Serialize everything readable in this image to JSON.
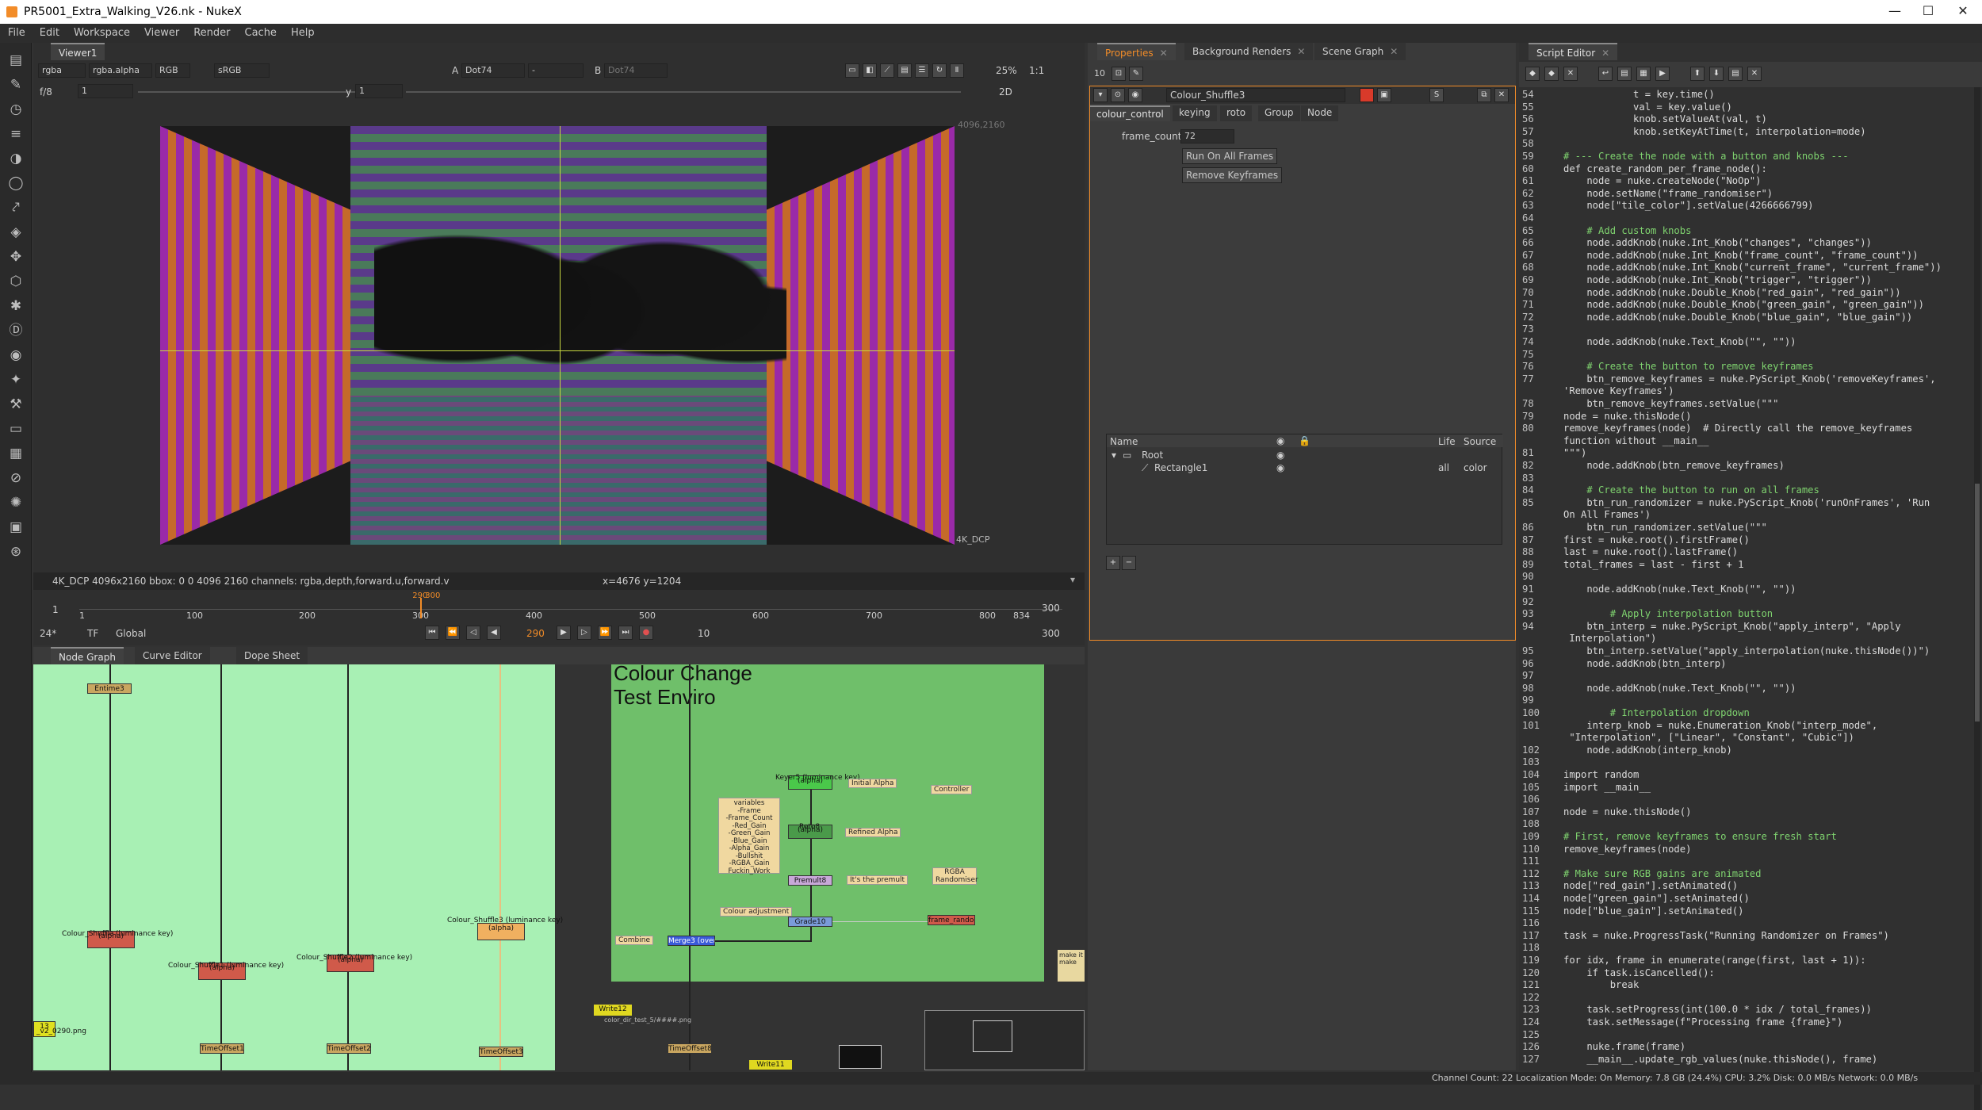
{
  "window": {
    "title": "PR5001_Extra_Walking_V26.nk - NukeX",
    "minimize": "—",
    "maximize": "☐",
    "close": "✕"
  },
  "menu": [
    "File",
    "Edit",
    "Workspace",
    "Viewer",
    "Render",
    "Cache",
    "Help"
  ],
  "viewer": {
    "tab": "Viewer1",
    "channels": "rgba",
    "alpha": "rgba.alpha",
    "colorspace_mode": "RGB",
    "lut": "sRGB",
    "input_a_label": "A",
    "input_a": "Dot74",
    "dash": "-",
    "input_b_label": "B",
    "input_b": "Dot74",
    "zoom": "25%",
    "ratio": "1:1",
    "fstop": "f/8",
    "frame_field": "1",
    "y_label": "y",
    "y_field": "1",
    "view_mode": "2D",
    "corner_tr": "4096,2160",
    "format_label": "4K_DCP",
    "info": "4K_DCP 4096x2160  bbox: 0 0 4096 2160 channels: rgba,depth,forward.u,forward.v",
    "coords": "x=4676 y=1204"
  },
  "timeline": {
    "start": "1",
    "end": "300",
    "ticks": [
      "1",
      "100",
      "200",
      "300",
      "400",
      "500",
      "600",
      "700",
      "800",
      "834"
    ],
    "marker_in": "290",
    "marker_out": "300",
    "fps": "24*",
    "tf": "TF",
    "scope": "Global",
    "current_frame": "290",
    "step": "10",
    "end_field": "300",
    "playhead_fraction": 0.347
  },
  "nodegraph": {
    "tabs": [
      "Node Graph",
      "Curve Editor",
      "Dope Sheet"
    ],
    "backdrop_title_1": "Colour Change",
    "backdrop_title_2": "Test Enviro",
    "nodes": {
      "shuffle0": "Colour_Shuffle (luminance key)",
      "shuffle0b": "(alpha)",
      "shuffle1": "Colour_Shuffle1 (luminance key)",
      "shuffle1b": "(alpha)",
      "shuffle2": "Colour_Shuffle2 (luminance key)",
      "shuffle2b": "(alpha)",
      "shuffle3": "Colour_Shuffle3 (luminance key)",
      "shuffle3b": "(alpha)",
      "timeoffset1": "TimeOffset1",
      "timeoffset2": "TimeOffset2",
      "timeoffset3": "TimeOffset3",
      "top_node": "Entime3",
      "keyer": "Keyer5 (luminance key)",
      "keyer_b": "(alpha)",
      "roto": "Roto8",
      "roto_b": "(alpha)",
      "premult": "Premult8",
      "grade": "Grade10",
      "merge": "Merge3 (over)",
      "timeoffset": "TimeOffset8",
      "write12": "Write12",
      "write11": "Write11",
      "write_path": "color_dir_test_5/####.png",
      "file_left": "13",
      "file_left_path": "_v2_0290.png",
      "sticky_initial": "Initial Alpha",
      "sticky_controller": "Controller",
      "sticky_refined": "Refined Alpha",
      "sticky_premult": "It's the premult",
      "sticky_rgba": "RGBA Randomiser",
      "sticky_colouradj": "Colour adjustment",
      "sticky_combine": "Combine",
      "sticky_random": "frame_randomiser",
      "sticky_make_1": "make it",
      "sticky_make_2": "make",
      "variables": [
        "variables",
        "-Frame",
        "-Frame_Count",
        "-Red_Gain",
        "-Green_Gain",
        "-Blue_Gain",
        "-Alpha_Gain",
        "-Bullshit",
        "-RGBA_Gain",
        "Fuckin_Work"
      ]
    }
  },
  "properties": {
    "tabs": [
      "Properties",
      "Background Renders",
      "Scene Graph"
    ],
    "count": "10",
    "node_name": "Colour_Shuffle3",
    "subtabs": [
      "colour_control",
      "keying",
      "roto",
      "Group",
      "Node"
    ],
    "frame_count_label": "frame_count",
    "frame_count_value": "72",
    "btn_run": "Run On All Frames",
    "btn_remove": "Remove Keyframes",
    "table_headers": [
      "Name",
      "Life",
      "Source"
    ],
    "rows": [
      {
        "name": "Root"
      },
      {
        "name": "Rectangle1",
        "life": "all",
        "source": "color"
      }
    ],
    "add_btn": "+",
    "remove_btn": "−"
  },
  "script": {
    "tab": "Script Editor",
    "status": "Channel Count: 22  Localization Mode: On  Memory: 7.8 GB (24.4%)  CPU: 3.2%  Disk: 0.0 MB/s  Network: 0.0 MB/s",
    "lines": [
      {
        "n": "54",
        "t": "            t = key.time()"
      },
      {
        "n": "55",
        "t": "            val = key.value()"
      },
      {
        "n": "56",
        "t": "            knob.setValueAt(val, t)"
      },
      {
        "n": "57",
        "t": "            knob.setKeyAtTime(t, interpolation=mode)"
      },
      {
        "n": "58",
        "t": ""
      },
      {
        "n": "59",
        "t": "# --- Create the node with a button and knobs ---",
        "c": "cm"
      },
      {
        "n": "60",
        "t": "def create_random_per_frame_node():"
      },
      {
        "n": "61",
        "t": "    node = nuke.createNode(\"NoOp\")"
      },
      {
        "n": "62",
        "t": "    node.setName(\"frame_randomiser\")"
      },
      {
        "n": "63",
        "t": "    node[\"tile_color\"].setValue(4266666799)"
      },
      {
        "n": "64",
        "t": ""
      },
      {
        "n": "65",
        "t": "    # Add custom knobs",
        "c": "cm"
      },
      {
        "n": "66",
        "t": "    node.addKnob(nuke.Int_Knob(\"changes\", \"changes\"))"
      },
      {
        "n": "67",
        "t": "    node.addKnob(nuke.Int_Knob(\"frame_count\", \"frame_count\"))"
      },
      {
        "n": "68",
        "t": "    node.addKnob(nuke.Int_Knob(\"current_frame\", \"current_frame\"))"
      },
      {
        "n": "69",
        "t": "    node.addKnob(nuke.Int_Knob(\"trigger\", \"trigger\"))"
      },
      {
        "n": "70",
        "t": "    node.addKnob(nuke.Double_Knob(\"red_gain\", \"red_gain\"))"
      },
      {
        "n": "71",
        "t": "    node.addKnob(nuke.Double_Knob(\"green_gain\", \"green_gain\"))"
      },
      {
        "n": "72",
        "t": "    node.addKnob(nuke.Double_Knob(\"blue_gain\", \"blue_gain\"))"
      },
      {
        "n": "73",
        "t": ""
      },
      {
        "n": "74",
        "t": "    node.addKnob(nuke.Text_Knob(\"\", \"\"))"
      },
      {
        "n": "75",
        "t": ""
      },
      {
        "n": "76",
        "t": "    # Create the button to remove keyframes",
        "c": "cm"
      },
      {
        "n": "77",
        "t": "    btn_remove_keyframes = nuke.PyScript_Knob('removeKeyframes',"
      },
      {
        "n": "",
        "t": "'Remove Keyframes')"
      },
      {
        "n": "78",
        "t": "    btn_remove_keyframes.setValue(\"\"\""
      },
      {
        "n": "79",
        "t": "node = nuke.thisNode()"
      },
      {
        "n": "80",
        "t": "remove_keyframes(node)  # Directly call the remove_keyframes"
      },
      {
        "n": "",
        "t": "function without __main__"
      },
      {
        "n": "81",
        "t": "\"\"\")"
      },
      {
        "n": "82",
        "t": "    node.addKnob(btn_remove_keyframes)"
      },
      {
        "n": "83",
        "t": ""
      },
      {
        "n": "84",
        "t": "    # Create the button to run on all frames",
        "c": "cm"
      },
      {
        "n": "85",
        "t": "    btn_run_randomizer = nuke.PyScript_Knob('runOnFrames', 'Run"
      },
      {
        "n": "",
        "t": "On All Frames')"
      },
      {
        "n": "86",
        "t": "    btn_run_randomizer.setValue(\"\"\""
      },
      {
        "n": "87",
        "t": "first = nuke.root().firstFrame()"
      },
      {
        "n": "88",
        "t": "last = nuke.root().lastFrame()"
      },
      {
        "n": "89",
        "t": "total_frames = last - first + 1"
      },
      {
        "n": "90",
        "t": ""
      },
      {
        "n": "91",
        "t": "    node.addKnob(nuke.Text_Knob(\"\", \"\"))"
      },
      {
        "n": "92",
        "t": ""
      },
      {
        "n": "93",
        "t": "        # Apply interpolation button",
        "c": "cm"
      },
      {
        "n": "94",
        "t": "    btn_interp = nuke.PyScript_Knob(\"apply_interp\", \"Apply"
      },
      {
        "n": "",
        "t": " Interpolation\")"
      },
      {
        "n": "95",
        "t": "    btn_interp.setValue(\"apply_interpolation(nuke.thisNode())\")"
      },
      {
        "n": "96",
        "t": "    node.addKnob(btn_interp)"
      },
      {
        "n": "97",
        "t": ""
      },
      {
        "n": "98",
        "t": "    node.addKnob(nuke.Text_Knob(\"\", \"\"))"
      },
      {
        "n": "99",
        "t": ""
      },
      {
        "n": "100",
        "t": "        # Interpolation dropdown",
        "c": "cm"
      },
      {
        "n": "101",
        "t": "    interp_knob = nuke.Enumeration_Knob(\"interp_mode\","
      },
      {
        "n": "",
        "t": " \"Interpolation\", [\"Linear\", \"Constant\", \"Cubic\"])"
      },
      {
        "n": "102",
        "t": "    node.addKnob(interp_knob)"
      },
      {
        "n": "103",
        "t": ""
      },
      {
        "n": "104",
        "t": "import random"
      },
      {
        "n": "105",
        "t": "import __main__"
      },
      {
        "n": "106",
        "t": ""
      },
      {
        "n": "107",
        "t": "node = nuke.thisNode()"
      },
      {
        "n": "108",
        "t": ""
      },
      {
        "n": "109",
        "t": "# First, remove keyframes to ensure fresh start",
        "c": "cm"
      },
      {
        "n": "110",
        "t": "remove_keyframes(node)"
      },
      {
        "n": "111",
        "t": ""
      },
      {
        "n": "112",
        "t": "# Make sure RGB gains are animated",
        "c": "cm"
      },
      {
        "n": "113",
        "t": "node[\"red_gain\"].setAnimated()"
      },
      {
        "n": "114",
        "t": "node[\"green_gain\"].setAnimated()"
      },
      {
        "n": "115",
        "t": "node[\"blue_gain\"].setAnimated()"
      },
      {
        "n": "116",
        "t": ""
      },
      {
        "n": "117",
        "t": "task = nuke.ProgressTask(\"Running Randomizer on Frames\")"
      },
      {
        "n": "118",
        "t": ""
      },
      {
        "n": "119",
        "t": "for idx, frame in enumerate(range(first, last + 1)):"
      },
      {
        "n": "120",
        "t": "    if task.isCancelled():"
      },
      {
        "n": "121",
        "t": "        break"
      },
      {
        "n": "122",
        "t": ""
      },
      {
        "n": "123",
        "t": "    task.setProgress(int(100.0 * idx / total_frames))"
      },
      {
        "n": "124",
        "t": "    task.setMessage(f\"Processing frame {frame}\")"
      },
      {
        "n": "125",
        "t": ""
      },
      {
        "n": "126",
        "t": "    nuke.frame(frame)"
      },
      {
        "n": "127",
        "t": "    __main__.update_rgb_values(nuke.thisNode(), frame)"
      }
    ]
  },
  "colors": {
    "nuke_orange": "#f28c28",
    "backdrop_green": "#6fbf6a",
    "graph_green": "#a8f0b4"
  }
}
